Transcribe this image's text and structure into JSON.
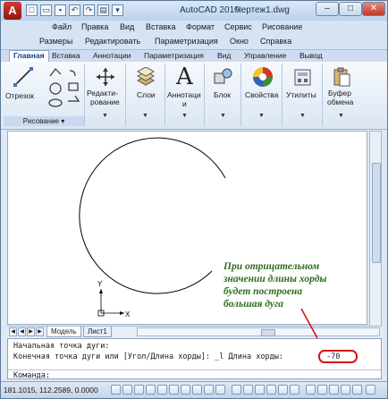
{
  "titlebar": {
    "app_title": "AutoCAD 2010",
    "doc_title": "Чертеж1.dwg",
    "logo_letter": "A"
  },
  "menu": {
    "row1": [
      "Файл",
      "Правка",
      "Вид",
      "Вставка",
      "Формат",
      "Сервис",
      "Рисование"
    ],
    "row2": [
      "Размеры",
      "Редактировать",
      "Параметризация",
      "Окно",
      "Справка"
    ]
  },
  "ribbon_tabs": [
    "Главная",
    "Вставка",
    "Аннотации",
    "Параметризация",
    "Вид",
    "Управление",
    "Вывод"
  ],
  "ribbon": {
    "line_label": "Отрезок",
    "draw_panel": "Рисование",
    "modify_label1": "Редакти-",
    "modify_label2": "рование",
    "layers_label": "Слои",
    "annot_label1": "Аннотаци",
    "annot_label2": "и",
    "block_label": "Блок",
    "props_label": "Свойства",
    "utils_label": "Утилиты",
    "clip_label1": "Буфер",
    "clip_label2": "обмена"
  },
  "layout_tabs": {
    "model": "Модель",
    "sheet1": "Лист1"
  },
  "ucs": {
    "x": "X",
    "y": "Y"
  },
  "command": {
    "line1": "Начальная точка дуги:",
    "line2": "Конечная точка дуги или [Угол/Длина хорды]: _l Длина хорды:",
    "value": "-70",
    "prompt": "Команда:"
  },
  "status": {
    "coords": "181.1015, 112.2589, 0.0000"
  },
  "annotation": {
    "line1": "При отрицательном",
    "line2": "значении длины хорды",
    "line3": "будет построена",
    "line4": "большая дуга"
  },
  "colors": {
    "annotation": "#2e6d1e",
    "highlight": "#d31414",
    "arc": "#000000"
  }
}
